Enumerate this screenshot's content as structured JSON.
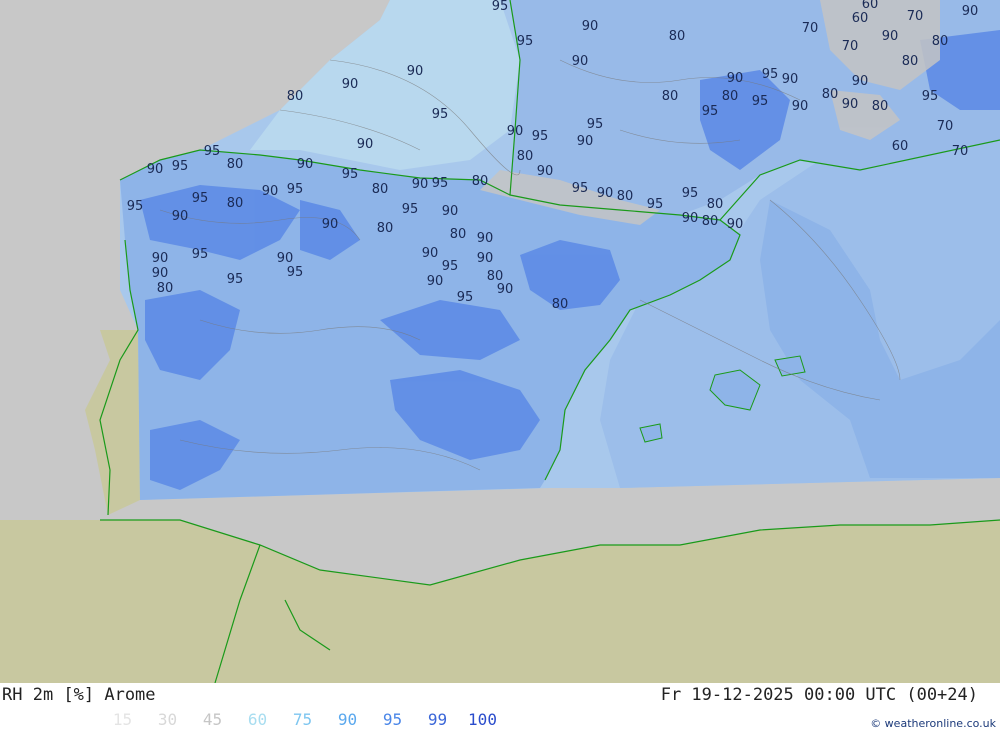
{
  "header": {
    "title_left": "RH 2m [%] Arome",
    "title_right": "Fr 19-12-2025 00:00 UTC (00+24)"
  },
  "legend": {
    "items": [
      {
        "label": "15",
        "color": "#e4e4e4"
      },
      {
        "label": "30",
        "color": "#d8d8d8"
      },
      {
        "label": "45",
        "color": "#c6c6c6"
      },
      {
        "label": "60",
        "color": "#a8ddf0"
      },
      {
        "label": "75",
        "color": "#7ec6f0"
      },
      {
        "label": "90",
        "color": "#5aa8ee"
      },
      {
        "label": "95",
        "color": "#4a86e8"
      },
      {
        "label": "99",
        "color": "#3a66d8"
      },
      {
        "label": "100",
        "color": "#2a4ccc"
      }
    ]
  },
  "credit": {
    "icon": "copyright-icon",
    "text": "© weatheronline.co.uk"
  },
  "map": {
    "colors": {
      "sea_outside": "#c8c8c8",
      "land_outside": "#c8c8a0",
      "rh_95": "#5e8ce6",
      "rh_90": "#8eb4e8",
      "rh_80": "#a8c8ec",
      "rh_70": "#b8d8ee",
      "rh_60": "#c4c4c4",
      "coast": "#1a9a1a",
      "contour": "#777777"
    },
    "contour_labels": [
      "90",
      "95",
      "90",
      "80",
      "70",
      "60",
      "70",
      "80",
      "90",
      "95",
      "60",
      "90",
      "70",
      "80",
      "90",
      "95",
      "80",
      "70",
      "60",
      "70",
      "90",
      "95",
      "90",
      "80",
      "80",
      "95",
      "90",
      "80",
      "90",
      "95",
      "90",
      "95",
      "90",
      "80",
      "90",
      "95",
      "80",
      "95",
      "90",
      "95",
      "90",
      "95",
      "80",
      "90",
      "95",
      "90",
      "95",
      "80",
      "90",
      "95",
      "90",
      "80",
      "95",
      "90",
      "80",
      "90",
      "95",
      "90",
      "95",
      "80",
      "90",
      "95",
      "90",
      "80",
      "95",
      "90",
      "80",
      "90",
      "95",
      "80",
      "90",
      "95",
      "90",
      "80",
      "95",
      "90",
      "95",
      "90",
      "80",
      "90",
      "95",
      "90",
      "80",
      "90",
      "95",
      "90",
      "80"
    ]
  }
}
